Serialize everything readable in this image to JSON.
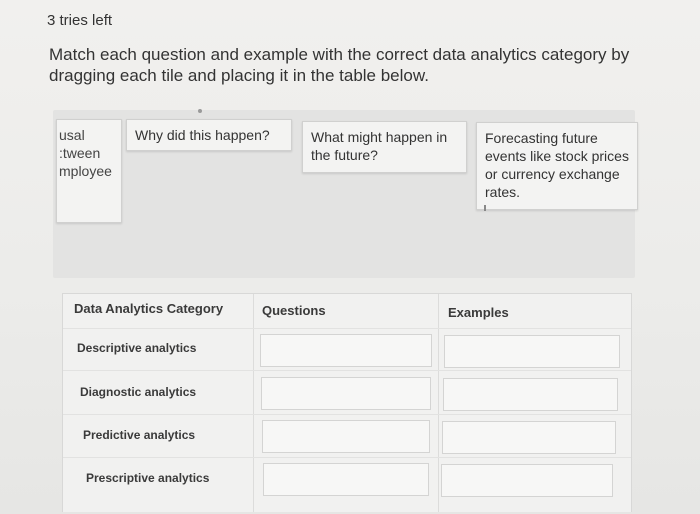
{
  "header": {
    "tries_left": "3 tries left",
    "instructions": "Match each question and example with the correct data analytics category by dragging each tile and placing it in the table below."
  },
  "tiles": [
    {
      "text": "usal\n:tween\nmployee"
    },
    {
      "text": "Why did this happen?"
    },
    {
      "text": "What might happen in the future?"
    },
    {
      "text": "Forecasting future events like stock prices or currency exchange rates."
    }
  ],
  "table": {
    "headers": [
      "Data Analytics Category",
      "Questions",
      "Examples"
    ],
    "rows": [
      {
        "category": "Descriptive analytics"
      },
      {
        "category": "Diagnostic analytics"
      },
      {
        "category": "Predictive analytics"
      },
      {
        "category": "Prescriptive analytics"
      }
    ]
  }
}
